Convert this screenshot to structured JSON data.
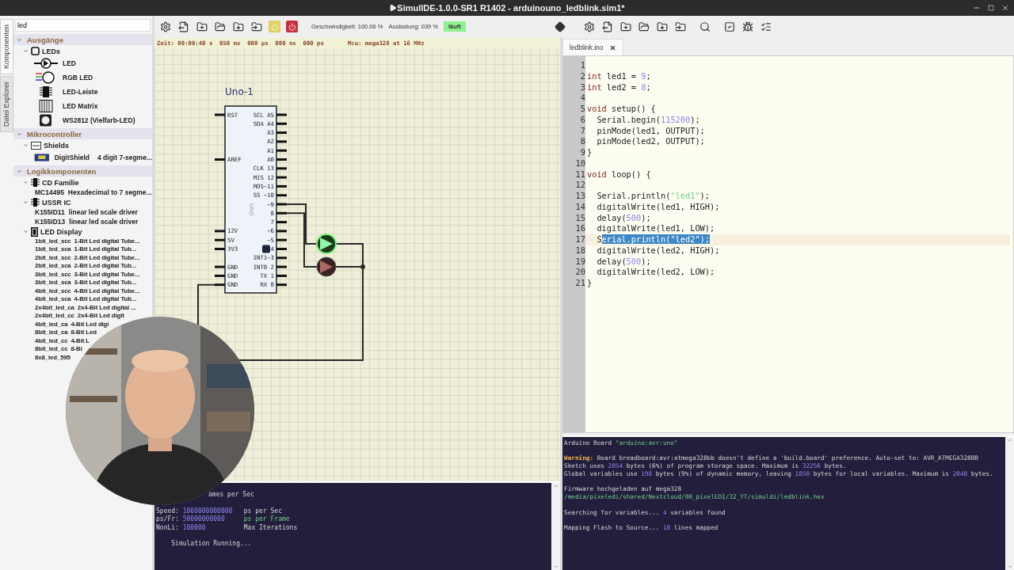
{
  "window": {
    "title": "SimulIDE-1.0.0-SR1 R1402 - arduinouno_ledblink.sim1*"
  },
  "sidebar": {
    "tabs": [
      {
        "label": "Komponenten",
        "selected": true
      },
      {
        "label": "Datei Explorer",
        "selected": false
      }
    ],
    "search": {
      "value": "led"
    },
    "tree": [
      {
        "label": "Ausgänge",
        "expanded": true,
        "children": [
          {
            "label": "LEDs",
            "kind": "box",
            "expanded": true,
            "children": [
              {
                "name": "LED",
                "kind": "led"
              },
              {
                "name": "RGB LED",
                "kind": "rgb"
              },
              {
                "name": "LED-Leiste",
                "kind": "bar"
              },
              {
                "name": "LED Matrix",
                "kind": "matrix"
              },
              {
                "name": "WS2812 (Vielfarb-LED)",
                "kind": "ws2812"
              }
            ]
          }
        ]
      },
      {
        "label": "Mikrocontroller",
        "expanded": true,
        "children": [
          {
            "label": "Shields",
            "kind": "shield",
            "expanded": true,
            "children": [
              {
                "name": "DigitShield",
                "description": "4 digit 7-segme...",
                "kind": "board"
              }
            ]
          }
        ]
      },
      {
        "label": "Logikkomponenten",
        "expanded": true,
        "children": [
          {
            "label": "CD Familie",
            "kind": "chip",
            "expanded": true,
            "children": [
              {
                "name": "MC14495",
                "description": "Hexadecimal to 7 segme...",
                "kind": "plain"
              }
            ]
          },
          {
            "label": "USSR IC",
            "kind": "chip",
            "expanded": true,
            "children": [
              {
                "name": "K155ID11",
                "description": "linear led scale driver",
                "kind": "plain"
              },
              {
                "name": "K155ID13",
                "description": "linear led scale driver",
                "kind": "plain"
              }
            ]
          },
          {
            "label": "LED Display",
            "kind": "display",
            "expanded": true,
            "children": [
              {
                "name": "1bit_led_scc",
                "description": "1-Bit Led digital Tube...",
                "kind": "compact"
              },
              {
                "name": "1bit_led_sca",
                "description": "1-Bit Led digital Tub...",
                "kind": "compact"
              },
              {
                "name": "2bit_led_scc",
                "description": "2-Bit Led digital Tube...",
                "kind": "compact"
              },
              {
                "name": "2bit_led_sca",
                "description": "2-Bit Led digital Tub...",
                "kind": "compact"
              },
              {
                "name": "3bit_led_scc",
                "description": "3-Bit Led digital Tube...",
                "kind": "compact"
              },
              {
                "name": "3bit_led_sca",
                "description": "3-Bit Led digital Tub...",
                "kind": "compact"
              },
              {
                "name": "4bit_led_scc",
                "description": "4-Bit Led digital Tube...",
                "kind": "compact"
              },
              {
                "name": "4bit_led_sca",
                "description": "4-Bit Led digital Tub...",
                "kind": "compact"
              },
              {
                "name": "2x4bit_led_ca",
                "description": "2x4-Bit Led digital ...",
                "kind": "compact"
              },
              {
                "name": "2x4bit_led_cc",
                "description": "2x4-Bit Led digit",
                "kind": "compact"
              },
              {
                "name": "4bit_led_ca",
                "description": "4-Bit Led digi",
                "kind": "compact"
              },
              {
                "name": "8bit_led_ca",
                "description": "8-Bit Led",
                "kind": "compact"
              },
              {
                "name": "4bit_led_cc",
                "description": "4-Bit L",
                "kind": "compact"
              },
              {
                "name": "8bit_led_cc",
                "description": "8-Bi",
                "kind": "compact"
              },
              {
                "name": "8x8_led_595",
                "kind": "compact"
              }
            ]
          }
        ]
      }
    ]
  },
  "toolbar": {
    "speed": "Geschwindigkeit: 100.06 %",
    "load": "Auslastung: 039 %",
    "status": "läuft",
    "running": true
  },
  "circuit": {
    "time": "Zeit: 00:00:40 s  050 ms  000 µs  000 ns  000 ps",
    "mcu": "Mcu: mega328 at 16 MHz",
    "board": {
      "name": "Uno-1",
      "label": "UNO",
      "left_pins": [
        "RST",
        "AREF",
        "12V",
        "5V",
        "3V3",
        "GND",
        "GND",
        "GND"
      ],
      "right_pins": [
        "SCL A5",
        "SDA A4",
        "A3",
        "A2",
        "A1",
        "A0",
        "CLK 13",
        "MIS 12",
        "MOS~11",
        "SS ~10",
        "~9",
        "8",
        "7",
        "~6",
        "~5",
        "4",
        "INT1~3",
        "INT0 2",
        "TX 1",
        "RX 0"
      ]
    },
    "leds": [
      {
        "lit": true,
        "color": "#8ff5a4"
      },
      {
        "lit": false,
        "color": "#a86a62"
      }
    ]
  },
  "sim_console": {
    "blocks": [
      [
        {
          "kind": "covered",
          "tokens": [
            {
              "text": "ames per Sec",
              "kind": "plain"
            }
          ]
        },
        {
          "tokens": [
            {
              "text": "Speed: ",
              "kind": "plain"
            },
            {
              "text": "1000000000000",
              "kind": "number"
            },
            {
              "text": "   ps per Sec",
              "kind": "plain"
            }
          ]
        },
        {
          "tokens": [
            {
              "text": "ps/Fr: ",
              "kind": "plain"
            },
            {
              "text": "50000000000     ",
              "kind": "number"
            },
            {
              "text": "ps per Frame",
              "kind": "string"
            }
          ]
        },
        {
          "tokens": [
            {
              "text": "NonLi: ",
              "kind": "plain"
            },
            {
              "text": "100000",
              "kind": "number"
            },
            {
              "text": "          Max Iterations",
              "kind": "plain"
            }
          ]
        }
      ],
      [
        {
          "tokens": [
            {
              "text": "    Simulation Running...",
              "kind": "plain"
            }
          ]
        }
      ]
    ]
  },
  "editor": {
    "tab": "ledblink.ino",
    "lines": [
      {
        "number": "1",
        "current": false
      },
      {
        "number": "2",
        "current": false,
        "tokens": [
          {
            "text": "int",
            "kind": "keyword"
          },
          {
            "text": " led1 = ",
            "kind": "plain"
          },
          {
            "text": "9",
            "kind": "number"
          },
          {
            "text": ";",
            "kind": "plain"
          }
        ]
      },
      {
        "number": "3",
        "current": false,
        "tokens": [
          {
            "text": "int",
            "kind": "keyword"
          },
          {
            "text": " led2 = ",
            "kind": "plain"
          },
          {
            "text": "8",
            "kind": "number"
          },
          {
            "text": ";",
            "kind": "plain"
          }
        ]
      },
      {
        "number": "4",
        "current": false
      },
      {
        "number": "5",
        "current": false,
        "tokens": [
          {
            "text": "void",
            "kind": "keyword"
          },
          {
            "text": " setup() {",
            "kind": "plain"
          }
        ]
      },
      {
        "number": "6",
        "current": false,
        "tokens": [
          {
            "text": "  Serial.begin(",
            "kind": "plain"
          },
          {
            "text": "115200",
            "kind": "number"
          },
          {
            "text": ");",
            "kind": "plain"
          }
        ]
      },
      {
        "number": "7",
        "current": false,
        "tokens": [
          {
            "text": "  pinMode(led1, OUTPUT);",
            "kind": "plain"
          }
        ]
      },
      {
        "number": "8",
        "current": false,
        "tokens": [
          {
            "text": "  pinMode(led2, OUTPUT);",
            "kind": "plain"
          }
        ]
      },
      {
        "number": "9",
        "current": false,
        "tokens": [
          {
            "text": "}",
            "kind": "plain"
          }
        ]
      },
      {
        "number": "10",
        "current": false
      },
      {
        "number": "11",
        "current": false,
        "tokens": [
          {
            "text": "void",
            "kind": "keyword"
          },
          {
            "text": " loop() {",
            "kind": "plain"
          }
        ]
      },
      {
        "number": "12",
        "current": false
      },
      {
        "number": "13",
        "current": false,
        "tokens": [
          {
            "text": "  Serial.println(",
            "kind": "plain"
          },
          {
            "text": "\"led1\"",
            "kind": "string"
          },
          {
            "text": ");",
            "kind": "plain"
          }
        ]
      },
      {
        "number": "14",
        "current": false,
        "tokens": [
          {
            "text": "  digitalWrite(led1, HIGH);",
            "kind": "plain"
          }
        ]
      },
      {
        "number": "15",
        "current": false,
        "tokens": [
          {
            "text": "  delay(",
            "kind": "plain"
          },
          {
            "text": "500",
            "kind": "number"
          },
          {
            "text": ");",
            "kind": "plain"
          }
        ]
      },
      {
        "number": "16",
        "current": false,
        "tokens": [
          {
            "text": "  digitalWrite(led1, LOW);",
            "kind": "plain"
          }
        ]
      },
      {
        "number": "17",
        "current": true,
        "tokens": [
          {
            "text": "  S",
            "kind": "plain"
          },
          {
            "text": "erial.println(\"led2\");",
            "kind": "selection"
          }
        ]
      },
      {
        "number": "18",
        "current": false,
        "tokens": [
          {
            "text": "  digitalWrite(led2, HIGH);",
            "kind": "plain"
          }
        ]
      },
      {
        "number": "19",
        "current": false,
        "tokens": [
          {
            "text": "  delay(",
            "kind": "plain"
          },
          {
            "text": "500",
            "kind": "number"
          },
          {
            "text": ");",
            "kind": "plain"
          }
        ]
      },
      {
        "number": "20",
        "current": false,
        "tokens": [
          {
            "text": "  digitalWrite(led2, LOW);",
            "kind": "plain"
          }
        ]
      },
      {
        "number": "21",
        "current": false,
        "tokens": [
          {
            "text": "}",
            "kind": "plain"
          }
        ]
      }
    ]
  },
  "output_console": {
    "blocks": [
      [
        {
          "tokens": [
            {
              "text": "Arduino Board ",
              "kind": "plain"
            },
            {
              "text": "\"arduino:avr:uno\"",
              "kind": "string"
            }
          ]
        }
      ],
      [
        {
          "tokens": [
            {
              "text": "Warning",
              "kind": "warning"
            },
            {
              "text": ": Board breadboard:avr:atmega328bb doesn't define a 'build.board' preference. Auto-set to: AVR_ATMEGA328BB",
              "kind": "plain"
            }
          ]
        },
        {
          "tokens": [
            {
              "text": "Sketch uses ",
              "kind": "plain"
            },
            {
              "text": "2054",
              "kind": "number"
            },
            {
              "text": " bytes (6%) of program storage space. Maximum is ",
              "kind": "plain"
            },
            {
              "text": "32256",
              "kind": "number"
            },
            {
              "text": " bytes.",
              "kind": "plain"
            }
          ]
        },
        {
          "tokens": [
            {
              "text": "Global variables use ",
              "kind": "plain"
            },
            {
              "text": "198",
              "kind": "number"
            },
            {
              "text": " bytes (9%) of dynamic memory, leaving ",
              "kind": "plain"
            },
            {
              "text": "1850",
              "kind": "number"
            },
            {
              "text": " bytes for local variables. Maximum is ",
              "kind": "plain"
            },
            {
              "text": "2048",
              "kind": "number"
            },
            {
              "text": " bytes.",
              "kind": "plain"
            }
          ]
        }
      ],
      [
        {
          "tokens": [
            {
              "text": "Firmware hochgeladen auf mega328",
              "kind": "plain"
            }
          ]
        },
        {
          "tokens": [
            {
              "text": "/media/pixeledi/shared/Nextcloud/00_pixelEDI/32_YT/simuldi/ledblink.hex",
              "kind": "string"
            }
          ]
        }
      ],
      [
        {
          "tokens": [
            {
              "text": "Searching for variables... ",
              "kind": "plain"
            },
            {
              "text": "4",
              "kind": "number"
            },
            {
              "text": " variables found",
              "kind": "plain"
            }
          ]
        }
      ],
      [
        {
          "tokens": [
            {
              "text": "Mapping Flash to Source... ",
              "kind": "plain"
            },
            {
              "text": "10",
              "kind": "number"
            },
            {
              "text": " lines mapped",
              "kind": "plain"
            }
          ]
        }
      ]
    ]
  }
}
